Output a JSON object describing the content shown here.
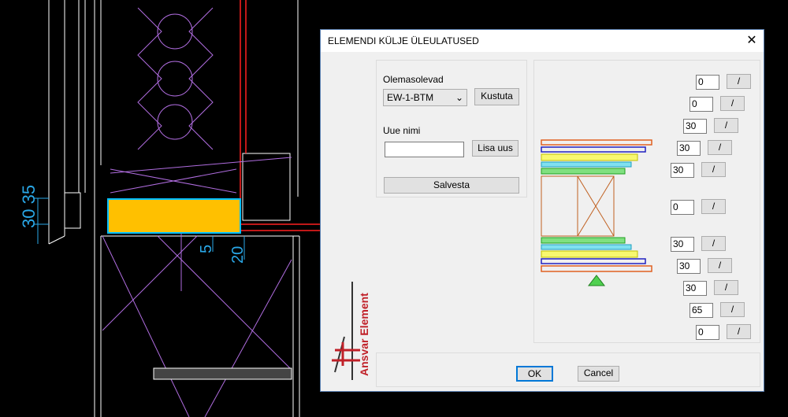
{
  "dialog": {
    "title": "ELEMENDI KÜLJE ÜLEULATUSED",
    "close_label": "✕",
    "existing_label": "Olemasolevad",
    "existing_value": "EW-1-BTM",
    "delete_label": "Kustuta",
    "new_name_label": "Uue nimi",
    "new_name_value": "",
    "add_new_label": "Lisa uus",
    "save_label": "Salvesta",
    "ok_label": "OK",
    "cancel_label": "Cancel",
    "logo_text": "Ansvar Element",
    "slash_label": "/",
    "layer_values": [
      "0",
      "0",
      "30",
      "30",
      "30",
      "0",
      "30",
      "30",
      "30",
      "65",
      "0"
    ]
  },
  "cad": {
    "dim_left": "30 35",
    "dim_5": "5",
    "dim_20": "20"
  }
}
